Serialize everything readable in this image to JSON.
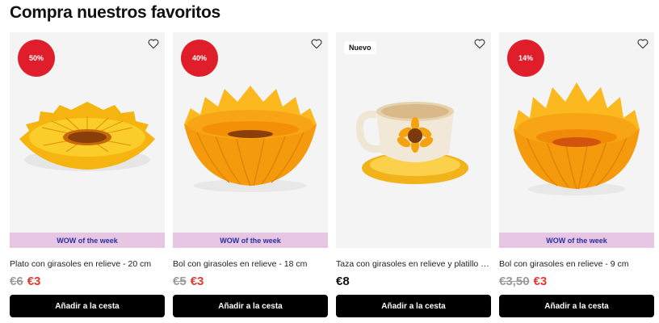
{
  "section": {
    "title": "Compra nuestros favoritos"
  },
  "products": [
    {
      "badge": "50%",
      "wow_label": "WOW of the week",
      "title": "Plato con girasoles en relieve - 20 cm",
      "old_price": "€6",
      "price": "€3",
      "cart_label": "Añadir a la cesta"
    },
    {
      "badge": "40%",
      "wow_label": "WOW of the week",
      "title": "Bol con girasoles en relieve - 18 cm",
      "old_price": "€5",
      "price": "€3",
      "cart_label": "Añadir a la cesta"
    },
    {
      "badge": "Nuevo",
      "title": "Taza con girasoles en relieve y platillo - 1...",
      "price": "€8",
      "cart_label": "Añadir a la cesta"
    },
    {
      "badge": "14%",
      "wow_label": "WOW of the week",
      "title": "Bol con girasoles en relieve - 9 cm",
      "old_price": "€3,50",
      "price": "€3",
      "cart_label": "Añadir a la cesta"
    }
  ],
  "colors": {
    "discount_badge": "#e01e2b",
    "wow_band": "#e6c6e3",
    "wow_text": "#2b2fa3",
    "sale_price": "#e23a2e",
    "button_bg": "#000000"
  },
  "icons": {
    "wishlist": "heart-outline-icon"
  }
}
